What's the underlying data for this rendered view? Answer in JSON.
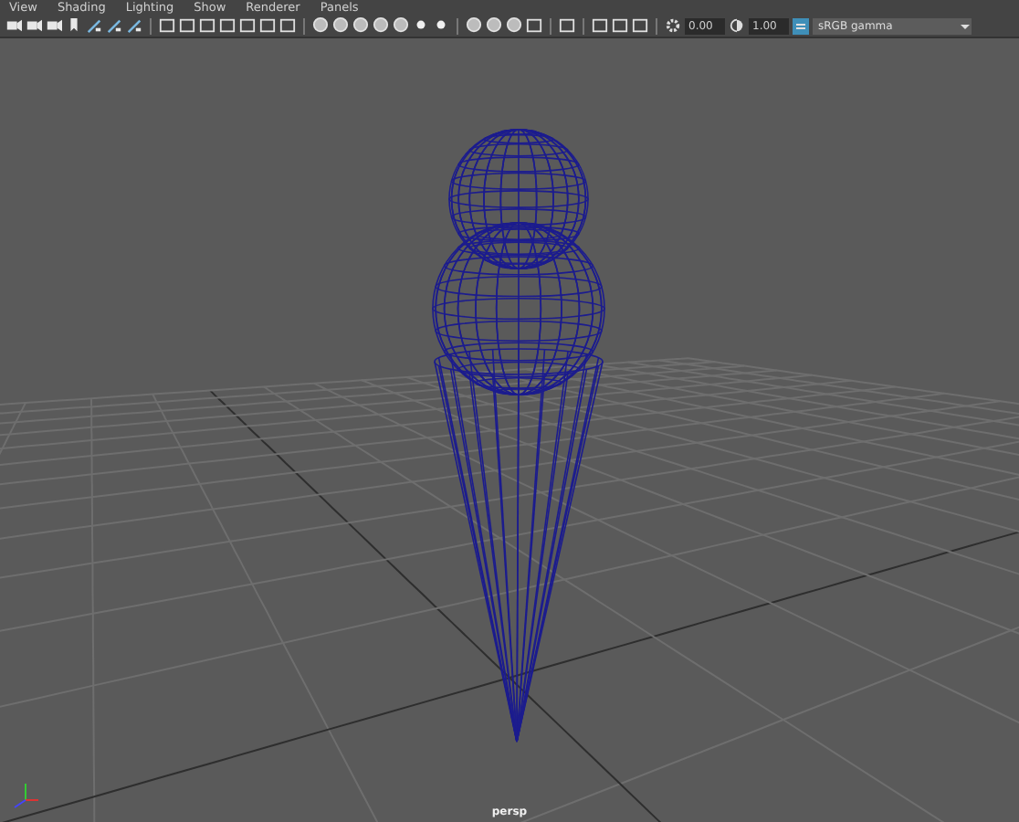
{
  "menu": [
    "View",
    "Shading",
    "Lighting",
    "Show",
    "Renderer",
    "Panels"
  ],
  "toolbar": {
    "exposure": "0.00",
    "gamma": "1.00",
    "color_management": {
      "on": true
    },
    "view_transform": "sRGB gamma"
  },
  "viewport": {
    "camera": "persp"
  }
}
